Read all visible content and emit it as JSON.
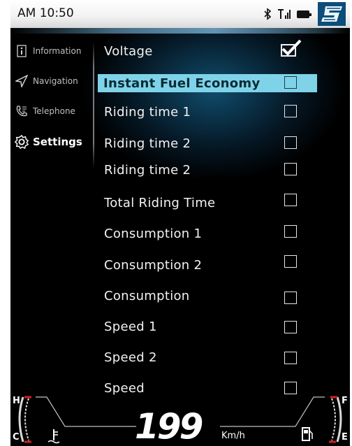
{
  "status": {
    "time": "AM 10:50"
  },
  "icons": {
    "bluetooth": "bluetooth-icon",
    "signal": "signal-icon",
    "battery": "battery-icon",
    "logo": "brand-logo-s"
  },
  "sidebar": {
    "items": [
      {
        "label": "Information",
        "icon": "info-icon"
      },
      {
        "label": "Navigation",
        "icon": "navigation-arrow-icon"
      },
      {
        "label": "Telephone",
        "icon": "phone-icon"
      },
      {
        "label": "Settings",
        "icon": "gear-icon"
      }
    ],
    "active": "Settings"
  },
  "settings_list": [
    {
      "label": "Voltage",
      "checked": true
    },
    {
      "label": "Instant Fuel Economy",
      "checked": false,
      "selected": true
    },
    {
      "label": "Riding time 1",
      "checked": false
    },
    {
      "label": "Riding time 2",
      "checked": false
    },
    {
      "label": "Riding time 2",
      "checked": false
    },
    {
      "label": "Total Riding Time",
      "checked": false
    },
    {
      "label": "Consumption 1",
      "checked": false
    },
    {
      "label": "Consumption 2",
      "checked": false
    },
    {
      "label": "Consumption",
      "checked": false
    },
    {
      "label": "Speed 1",
      "checked": false
    },
    {
      "label": "Speed 2",
      "checked": false
    },
    {
      "label": "Speed",
      "checked": false
    }
  ],
  "gauges": {
    "temp_high": "H",
    "temp_low": "C",
    "fuel_full": "F",
    "fuel_empty": "E",
    "speed_value": "199",
    "speed_unit": "Km/h"
  },
  "colors": {
    "highlight": "#7fd3e8",
    "accent_red": "#d21f1f",
    "logo_blue": "#0c4d7a"
  }
}
